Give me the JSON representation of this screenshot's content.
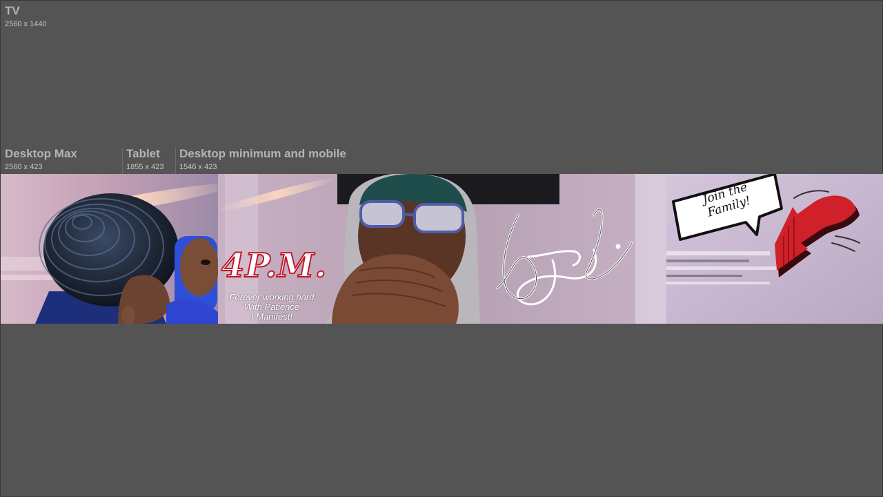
{
  "labels": {
    "tv": {
      "title": "TV",
      "dims": "2560 x 1440"
    },
    "desktop_max": {
      "title": "Desktop Max",
      "dims": "2560 x 423"
    },
    "tablet": {
      "title": "Tablet",
      "dims": "1855 x 423"
    },
    "desktop_min": {
      "title": "Desktop minimum and mobile",
      "dims": "1546 x 423"
    }
  },
  "banner": {
    "brand": "4P.M.",
    "motto": [
      "Forever working hard",
      "With Patience",
      "I Manifest!"
    ],
    "bubble": [
      "Join the",
      "Family!"
    ],
    "signature": "signature-graphic",
    "arrow": "red-arrow-icon",
    "colors": {
      "background": "#545454",
      "banner_purple": "#c4aec6",
      "arrow_red": "#d0202a",
      "brand_outline": "#c01a2a"
    }
  }
}
